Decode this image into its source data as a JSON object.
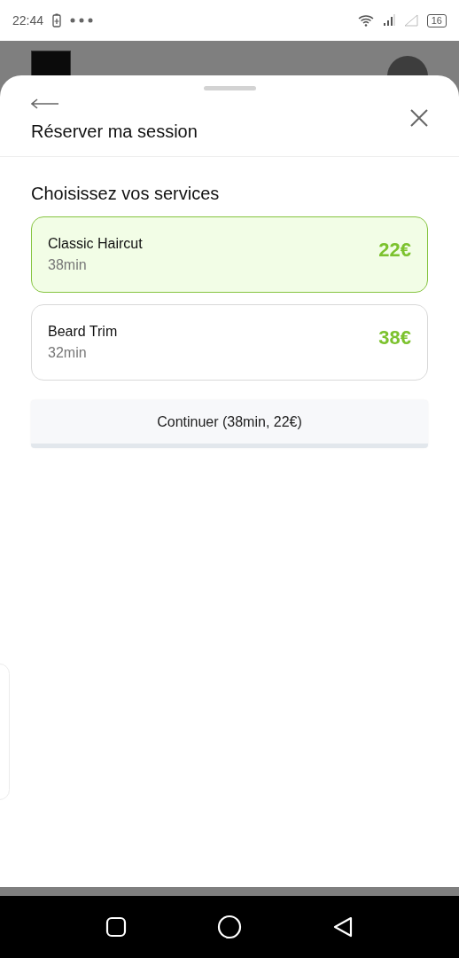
{
  "status_bar": {
    "time": "22:44",
    "battery": "16"
  },
  "sheet": {
    "title": "Réserver ma session",
    "section_title": "Choisissez vos services",
    "services": [
      {
        "name": "Classic Haircut",
        "duration": "38min",
        "price": "22€",
        "selected": true
      },
      {
        "name": "Beard Trim",
        "duration": "32min",
        "price": "38€",
        "selected": false
      }
    ],
    "continue_button": "Continuer (38min, 22€)"
  }
}
